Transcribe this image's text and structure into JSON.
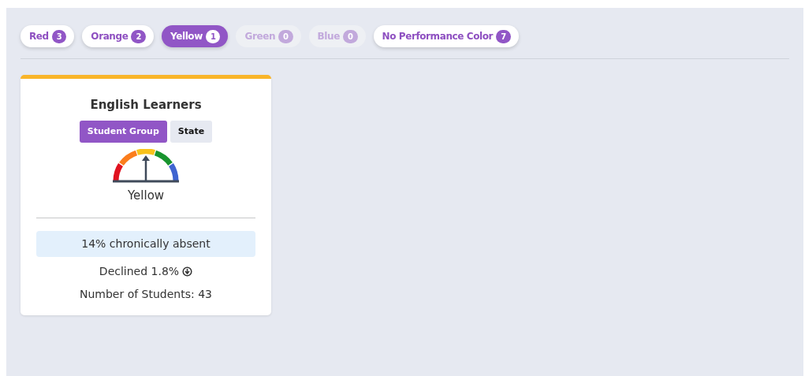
{
  "filters": [
    {
      "label": "Red",
      "count": "3",
      "selected": false,
      "disabled": false
    },
    {
      "label": "Orange",
      "count": "2",
      "selected": false,
      "disabled": false
    },
    {
      "label": "Yellow",
      "count": "1",
      "selected": true,
      "disabled": false
    },
    {
      "label": "Green",
      "count": "0",
      "selected": false,
      "disabled": true
    },
    {
      "label": "Blue",
      "count": "0",
      "selected": false,
      "disabled": true
    },
    {
      "label": "No Performance Color",
      "count": "7",
      "selected": false,
      "disabled": false
    }
  ],
  "cards": [
    {
      "title": "English Learners",
      "color": "#f9b529",
      "toggles": [
        {
          "label": "Student Group",
          "selected": true
        },
        {
          "label": "State",
          "selected": false
        }
      ],
      "performance": "Yellow",
      "rate": "14% chronically absent",
      "change": "Declined 1.8%",
      "students": "Number of Students: 43"
    }
  ]
}
